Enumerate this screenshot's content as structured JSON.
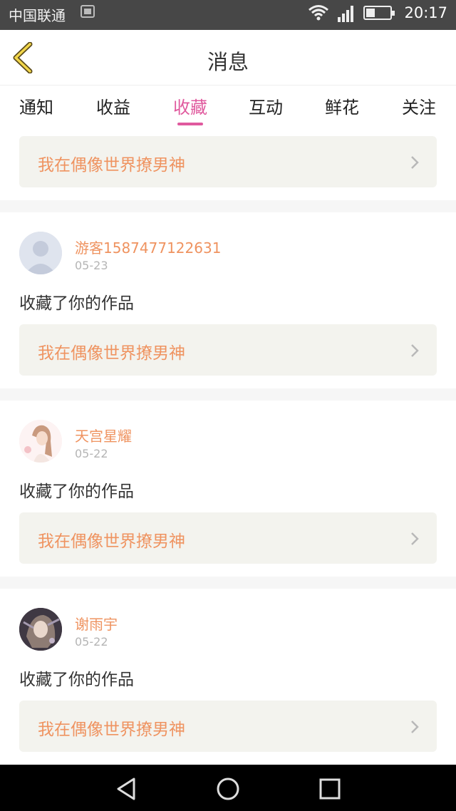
{
  "status_bar": {
    "carrier": "中国联通",
    "time": "20:17",
    "icons": [
      "sim-icon",
      "wifi-icon",
      "signal-icon",
      "battery-icon"
    ]
  },
  "header": {
    "title": "消息",
    "back_icon": "chevron-left-icon"
  },
  "tabs": [
    {
      "label": "通知",
      "active": false
    },
    {
      "label": "收益",
      "active": false
    },
    {
      "label": "收藏",
      "active": true
    },
    {
      "label": "互动",
      "active": false
    },
    {
      "label": "鲜花",
      "active": false
    },
    {
      "label": "关注",
      "active": false
    }
  ],
  "colors": {
    "accent": "#e05a9e",
    "highlight_text": "#ef9360",
    "work_box_bg": "#f3f3ee"
  },
  "first_card": {
    "work_title": "我在偶像世界撩男神"
  },
  "messages": [
    {
      "username": "游客1587477122631",
      "date": "05-23",
      "action": "收藏了你的作品",
      "work_title": "我在偶像世界撩男神",
      "avatar": "default-avatar"
    },
    {
      "username": "天宫星耀",
      "date": "05-22",
      "action": "收藏了你的作品",
      "work_title": "我在偶像世界撩男神",
      "avatar": "girl-avatar"
    },
    {
      "username": "谢雨宇",
      "date": "05-22",
      "action": "收藏了你的作品",
      "work_title": "我在偶像世界撩男神",
      "avatar": "anime-avatar"
    }
  ],
  "nav_bar": {
    "buttons": [
      "back-triangle-icon",
      "home-circle-icon",
      "recents-square-icon"
    ]
  }
}
